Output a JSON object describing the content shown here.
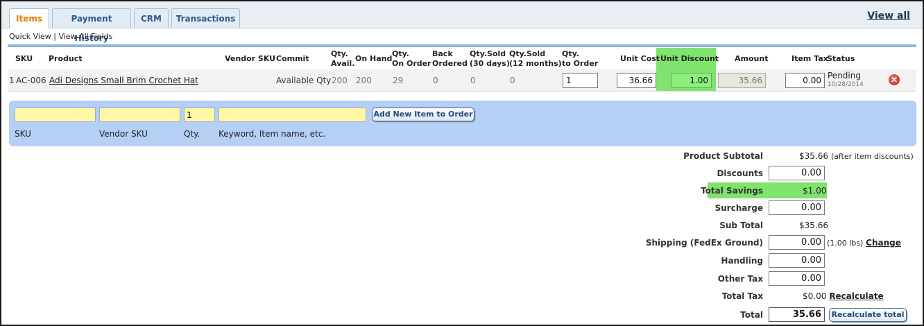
{
  "tabs": [
    {
      "label": "Items"
    },
    {
      "label": "Payment History"
    },
    {
      "label": "CRM"
    },
    {
      "label": "Transactions"
    }
  ],
  "view_all": "View all",
  "quick_view": "Quick View",
  "view_all_fields": "View All Fields",
  "separator": "|",
  "columns": {
    "sku": "SKU",
    "product": "Product",
    "vendor_sku": "Vendor SKU",
    "commit": "Commit",
    "qty_avail": "Qty.\nAvail.",
    "on_hand": "On Hand",
    "qty_on_order": "Qty.\nOn Order",
    "back_ordered": "Back\nOrdered",
    "qty_sold_30": "Qty.Sold\n(30 days)",
    "qty_sold_12": "Qty.Sold\n(12 months)",
    "qty_to_order": "Qty.\nto Order",
    "unit_cost": "Unit Cost",
    "unit_discount": "Unit Discount",
    "amount": "Amount",
    "item_tax": "Item Tax",
    "status": "Status"
  },
  "item": {
    "line": "1",
    "sku": "AC-006",
    "product": "Adi Designs Small Brim Crochet Hat",
    "commit": "Available Qty",
    "qty_avail": "200",
    "on_hand": "200",
    "qty_on_order": "29",
    "back_ordered": "0",
    "qty_sold_30": "0",
    "qty_sold_12": "0",
    "qty_to_order": "1",
    "unit_cost": "36.66",
    "unit_discount": "1.00",
    "amount": "35.66",
    "item_tax": "0.00",
    "status": "Pending",
    "status_date": "10/28/2014"
  },
  "add_item": {
    "qty_value": "1",
    "button": "Add New Item to Order",
    "sku_label": "SKU",
    "vendor_sku_label": "Vendor SKU",
    "qty_label": "Qty.",
    "keyword_label": "Keyword, Item name, etc."
  },
  "totals": {
    "product_subtotal_label": "Product Subtotal",
    "product_subtotal_value": "$35.66",
    "product_subtotal_note": "(after item discounts)",
    "discounts_label": "Discounts",
    "discounts_value": "0.00",
    "total_savings_label": "Total Savings",
    "total_savings_value": "$1.00",
    "surcharge_label": "Surcharge",
    "surcharge_value": "0.00",
    "sub_total_label": "Sub Total",
    "sub_total_value": "$35.66",
    "shipping_label": "Shipping (FedEx Ground)",
    "shipping_value": "0.00",
    "shipping_weight": "(1.00 lbs)",
    "shipping_change": "Change",
    "handling_label": "Handling",
    "handling_value": "0.00",
    "other_tax_label": "Other Tax",
    "other_tax_value": "0.00",
    "total_tax_label": "Total Tax",
    "total_tax_value": "$0.00",
    "recalculate_link": "Recalculate",
    "total_label": "Total",
    "total_value": "35.66",
    "recalculate_total_button": "Recalculate total"
  },
  "colors": {
    "highlight_green": "#7fe36e",
    "panel_blue": "#b5cff5",
    "input_yellow": "#fff7a6",
    "active_tab": "#e07b00"
  }
}
